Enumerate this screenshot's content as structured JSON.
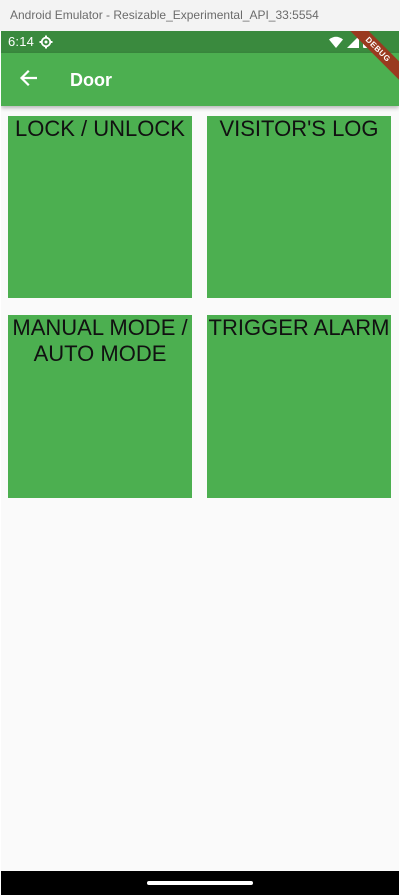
{
  "window": {
    "title": "Android Emulator - Resizable_Experimental_API_33:5554"
  },
  "status_bar": {
    "time": "6:14",
    "icons": [
      "settings-gear-icon",
      "wifi-icon",
      "signal-icon",
      "battery-icon"
    ]
  },
  "app_bar": {
    "title": "Door",
    "back_icon": "arrow-back-icon",
    "color": "#4caf50"
  },
  "debug_banner": {
    "label": "DEBUG",
    "color": "#9a3a1f"
  },
  "tiles": [
    {
      "label": "LOCK / UNLOCK"
    },
    {
      "label": "VISITOR'S LOG"
    },
    {
      "label": "MANUAL MODE / AUTO MODE"
    },
    {
      "label": "TRIGGER ALARM"
    }
  ],
  "colors": {
    "tile": "#4caf50",
    "status_bar": "#3a8a3e",
    "background": "#fafafa"
  }
}
